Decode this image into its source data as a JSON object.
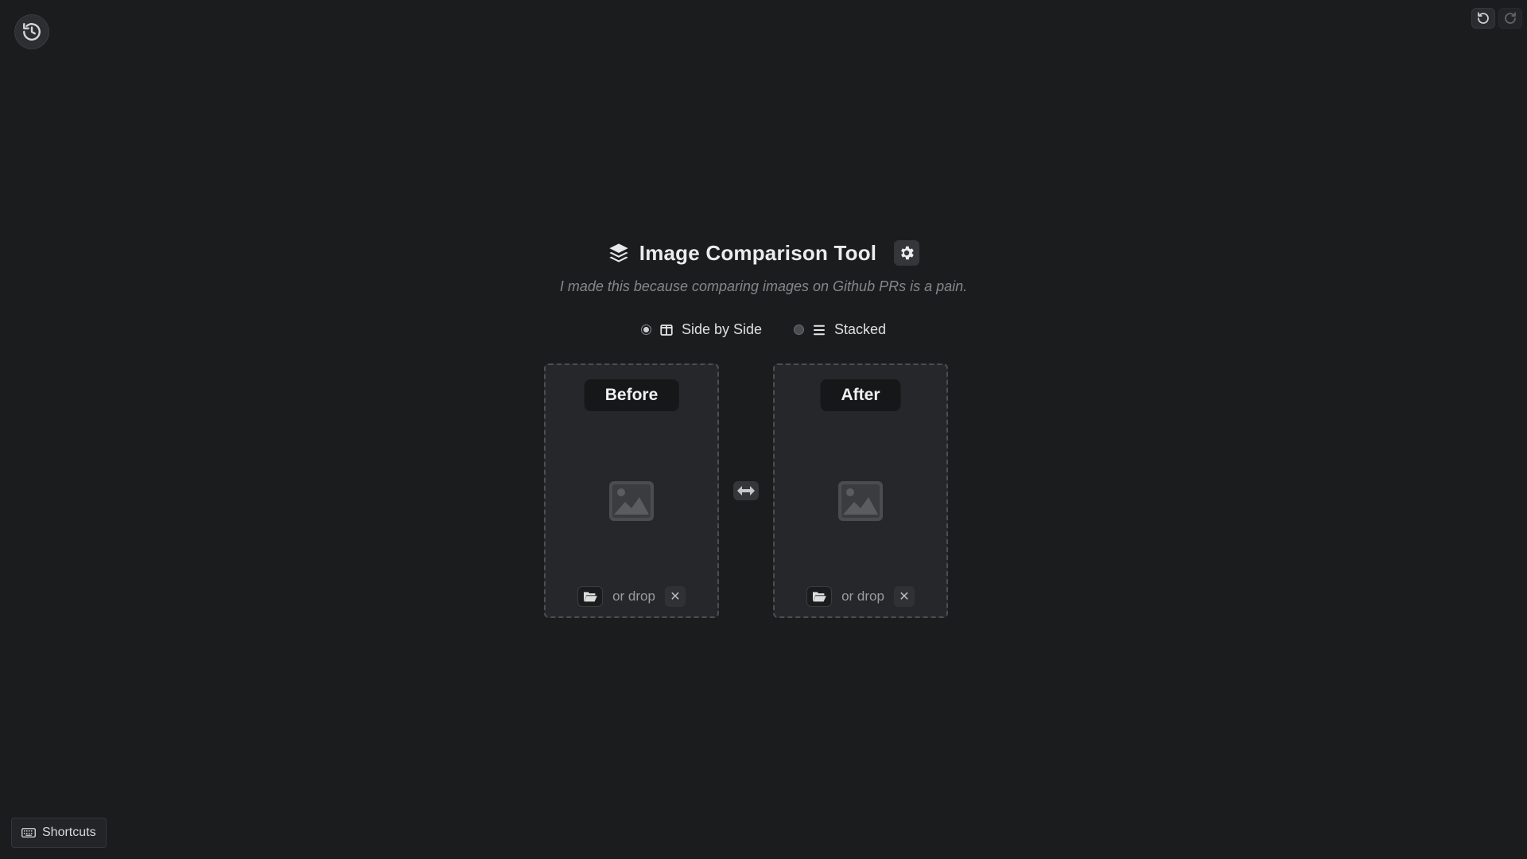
{
  "header": {
    "title": "Image Comparison Tool",
    "subtitle": "I made this because comparing images on Github PRs is a pain.",
    "title_icon": "layers-icon",
    "settings_icon": "gear-icon"
  },
  "top_left": {
    "icon": "history-icon"
  },
  "top_right": {
    "undo_icon": "undo-icon",
    "redo_icon": "redo-icon"
  },
  "view_modes": [
    {
      "label": "Side by Side",
      "icon": "columns-icon",
      "selected": true
    },
    {
      "label": "Stacked",
      "icon": "list-icon",
      "selected": false
    }
  ],
  "panels": {
    "before": {
      "label": "Before",
      "drop_text": "or drop",
      "open_icon": "folder-open-icon",
      "clear_icon": "close-icon",
      "placeholder_icon": "image-icon"
    },
    "after": {
      "label": "After",
      "drop_text": "or drop",
      "open_icon": "folder-open-icon",
      "clear_icon": "close-icon",
      "placeholder_icon": "image-icon"
    },
    "swap_icon": "swap-arrows-icon"
  },
  "footer": {
    "shortcuts_label": "Shortcuts",
    "shortcuts_icon": "keyboard-icon"
  },
  "colors": {
    "background": "#1b1c1e",
    "panel": "#25272a",
    "text": "#e6e6e6",
    "muted": "#85878b"
  }
}
